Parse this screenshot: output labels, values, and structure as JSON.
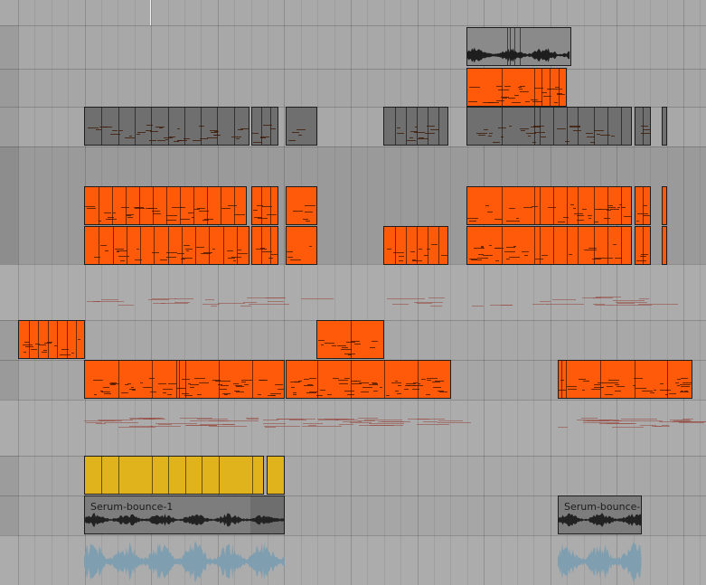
{
  "app": {
    "view": "arrangement"
  },
  "colors": {
    "background": "#a9a9a9",
    "midi_orange": "#ff5a0a",
    "clip_gray": "#787878",
    "clip_yellow": "#e0b21c",
    "audio_gray": "#7d7d7d",
    "waveform_blue": "#7f9fb0"
  },
  "clips": {
    "serum_bounce_1": {
      "label": "Serum-bounce-1"
    },
    "serum_bounce_2": {
      "label": "Serum-bounce-1"
    }
  }
}
